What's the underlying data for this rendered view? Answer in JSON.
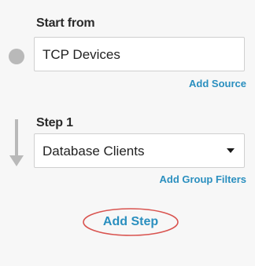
{
  "start": {
    "label": "Start from",
    "source_value": "TCP Devices",
    "add_source_link": "Add Source"
  },
  "step1": {
    "label": "Step 1",
    "selected_value": "Database Clients",
    "add_group_filters_link": "Add Group Filters"
  },
  "add_step_button": "Add Step",
  "colors": {
    "link": "#2a8fbf",
    "highlight_oval": "#d9534f",
    "indicator": "#b9b9b9"
  }
}
